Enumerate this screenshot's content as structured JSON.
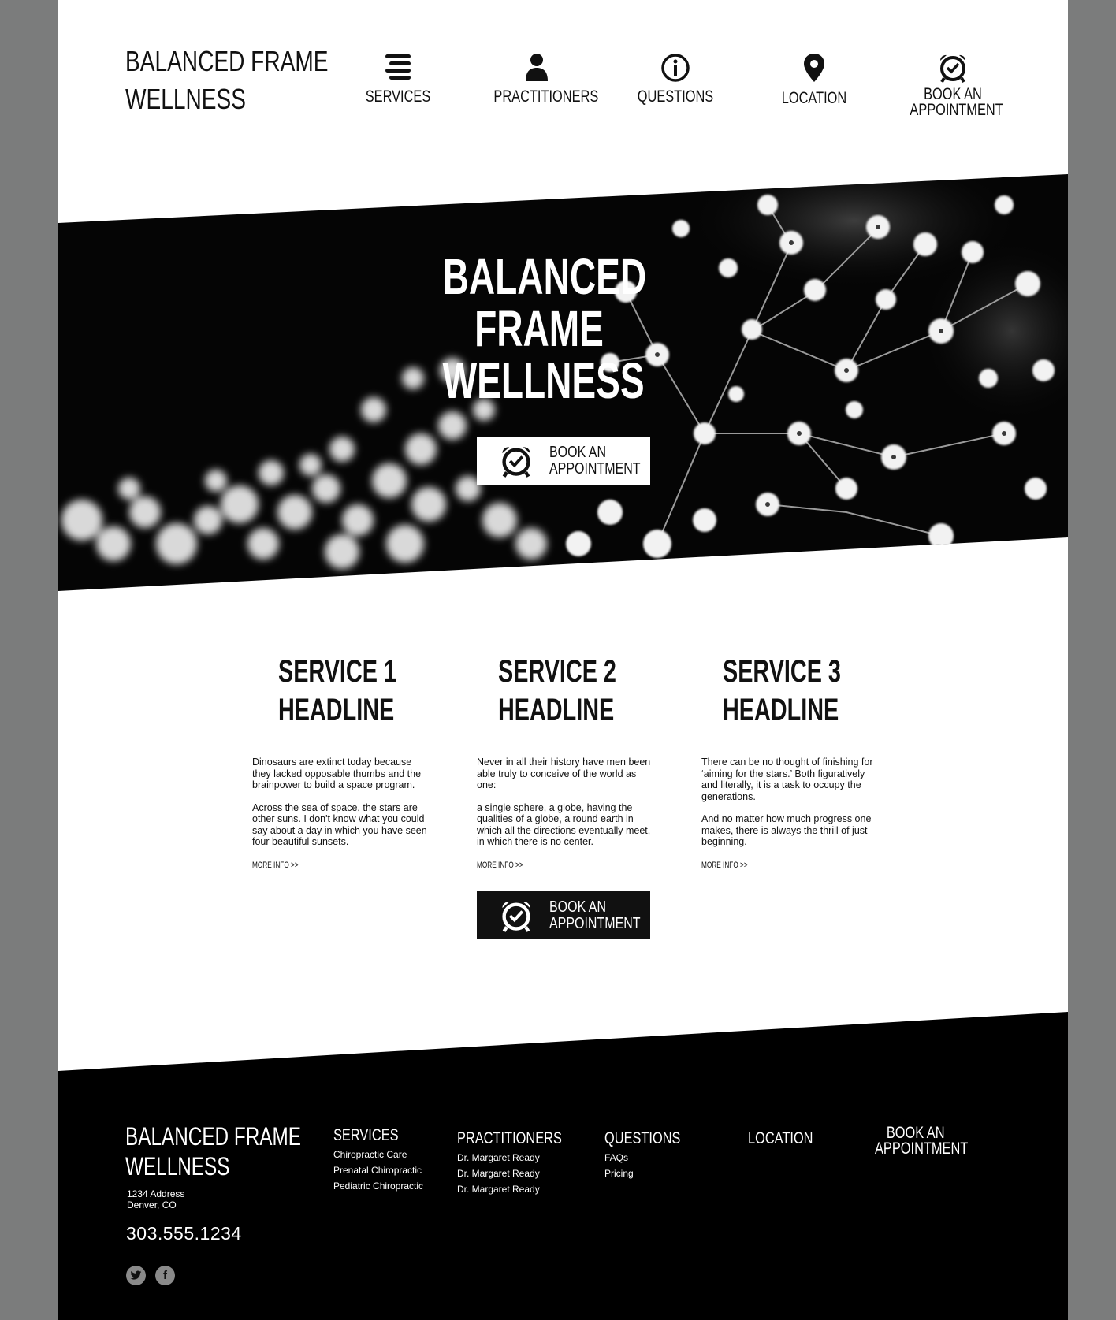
{
  "colors": {
    "frame": "#7b7c7c",
    "page": "#ffffff",
    "dark": "#000000",
    "text": "#111111"
  },
  "header": {
    "logo_line1": "BALANCED FRAME",
    "logo_line2": "WELLNESS",
    "nav": [
      {
        "label": "SERVICES",
        "icon": "menu-icon"
      },
      {
        "label": "PRACTITIONERS",
        "icon": "person-icon"
      },
      {
        "label": "QUESTIONS",
        "icon": "info-icon"
      },
      {
        "label": "LOCATION",
        "icon": "map-pin-icon"
      },
      {
        "label_line1": "BOOK AN",
        "label_line2": "APPOINTMENT",
        "icon": "alarm-clock-icon"
      }
    ]
  },
  "hero": {
    "title_line1": "BALANCED",
    "title_line2": "FRAME",
    "title_line3": "WELLNESS",
    "button_line1": "BOOK AN",
    "button_line2": "APPOINTMENT"
  },
  "services": [
    {
      "head_line1": "SERVICE 1",
      "head_line2": "HEADLINE",
      "para1": "Dinosaurs are extinct today because they lacked opposable thumbs and the brainpower to build a space program.",
      "para2": "Across the sea of space, the stars are other suns. I don't know what you could say about a day in which you have seen four beautiful sunsets.",
      "more": "MORE INFO >>"
    },
    {
      "head_line1": "SERVICE 2",
      "head_line2": "HEADLINE",
      "para1": "Never in all their history have men been able truly to conceive of the world as one:",
      "para2": "a single sphere, a globe, having the qualities of a globe, a round earth in which all the directions eventually meet, in which there is no center.",
      "more": "MORE INFO >>"
    },
    {
      "head_line1": "SERVICE 3",
      "head_line2": "HEADLINE",
      "para1": "There can be no thought of finishing for ‘aiming for the stars.’ Both figuratively and literally, it is a task to occupy the generations.",
      "para2": "And no matter how much progress one makes, there is always the thrill of just beginning.",
      "more": "MORE INFO >>"
    }
  ],
  "cta": {
    "button_line1": "BOOK AN",
    "button_line2": "APPOINTMENT"
  },
  "footer": {
    "logo_line1": "BALANCED FRAME",
    "logo_line2": "WELLNESS",
    "address_line1": "1234 Address",
    "address_line2": "Denver, CO",
    "phone": "303.555.1234",
    "social": [
      {
        "icon": "twitter-icon"
      },
      {
        "icon": "facebook-icon",
        "glyph": "f"
      }
    ],
    "columns": {
      "services": {
        "heading": "SERVICES",
        "links": [
          "Chiropractic Care",
          "Prenatal Chiropractic",
          "Pediatric Chiropractic"
        ]
      },
      "practitioners": {
        "heading": "PRACTITIONERS",
        "links": [
          "Dr. Margaret Ready",
          "Dr. Margaret Ready",
          "Dr. Margaret Ready"
        ]
      },
      "questions": {
        "heading": "QUESTIONS",
        "links": [
          "FAQs",
          "Pricing"
        ]
      },
      "location": {
        "heading": "LOCATION"
      },
      "book": {
        "heading_line1": "BOOK AN",
        "heading_line2": "APPOINTMENT"
      }
    }
  }
}
